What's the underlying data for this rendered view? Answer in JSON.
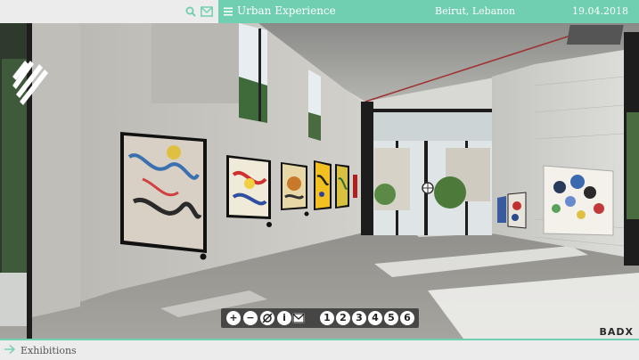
{
  "header": {
    "title": "Urban Experience",
    "location": "Beirut, Lebanon",
    "date": "19.04.2018"
  },
  "icons": {
    "search": "search-icon",
    "mail": "mail-icon",
    "menu": "menu-icon",
    "arrow": "arrow-right-icon"
  },
  "toolbar": {
    "zoom_in": "+",
    "zoom_out": "−",
    "info": "i",
    "rooms": [
      "1",
      "2",
      "3",
      "4",
      "5",
      "6"
    ]
  },
  "brand": "BADX",
  "footer": {
    "label": "Exhibitions"
  },
  "colors": {
    "accent": "#6fcfb0",
    "bar_light": "#ececec"
  }
}
